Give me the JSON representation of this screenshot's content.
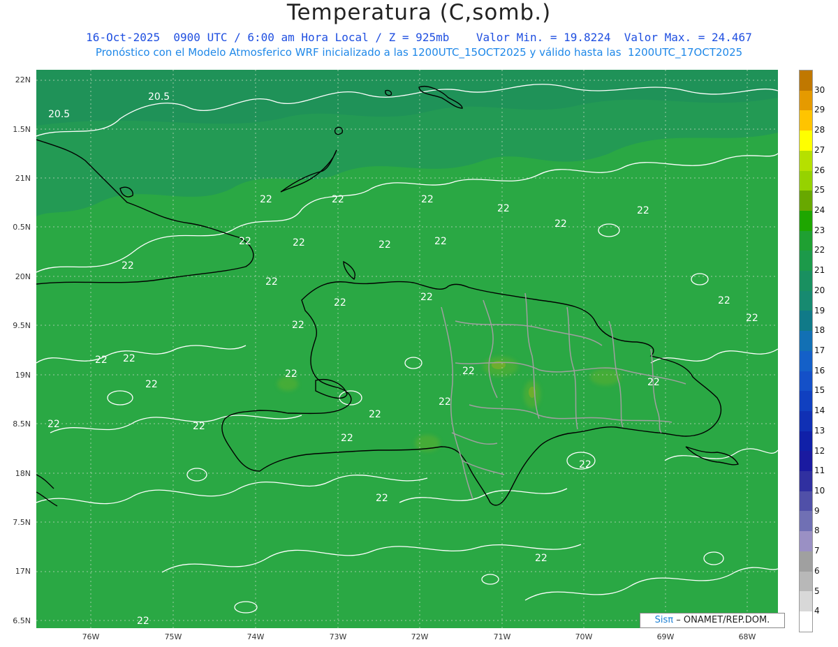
{
  "title": "Temperatura (C,somb.)",
  "subtitle1": "16-Oct-2025  0900 UTC / 6:00 am Hora Local / Z = 925mb    Valor Min. = 19.8224  Valor Max. = 24.467",
  "subtitle2": "Pronóstico con el Modelo Atmosferico WRF inicializado a las 1200UTC_15OCT2025 y válido hasta las  1200UTC_17OCT2025",
  "lat_labels": [
    "22N",
    "1.5N",
    "21N",
    "0.5N",
    "20N",
    "9.5N",
    "19N",
    "8.5N",
    "18N",
    "7.5N",
    "17N",
    "6.5N"
  ],
  "lon_labels": [
    "76W",
    "75W",
    "74W",
    "73W",
    "72W",
    "71W",
    "70W",
    "69W",
    "68W"
  ],
  "contour_labels": [
    "20.5",
    "20.5",
    "22",
    "22",
    "22",
    "22",
    "22",
    "22",
    "22",
    "22",
    "22",
    "22",
    "22",
    "22",
    "22",
    "22",
    "22",
    "22",
    "22",
    "22",
    "22",
    "22",
    "22",
    "22",
    "22",
    "22",
    "22",
    "22",
    "22",
    "22",
    "22",
    "22",
    "22",
    "22"
  ],
  "colorbar": {
    "labels": [
      "30",
      "29",
      "28",
      "27",
      "26",
      "25",
      "24",
      "23",
      "22",
      "21",
      "20",
      "19",
      "18",
      "17",
      "16",
      "15",
      "14",
      "13",
      "12",
      "11",
      "10",
      "9",
      "8",
      "7",
      "6",
      "5",
      "4"
    ],
    "colors": [
      "#c07800",
      "#e59a00",
      "#ffc400",
      "#ffff00",
      "#b6e000",
      "#96d200",
      "#68a800",
      "#1ea600",
      "#1fa032",
      "#1c9a4a",
      "#199060",
      "#178a70",
      "#107a88",
      "#1270b4",
      "#1460c8",
      "#1450c8",
      "#1040c0",
      "#1030b4",
      "#1020a8",
      "#1a1aa0",
      "#3030a0",
      "#5050a8",
      "#7070b4",
      "#9a90c4",
      "#a0a0a0",
      "#b8b8b8",
      "#d8d8d8",
      "#ffffff"
    ]
  },
  "credit_brand": "Sisπ",
  "credit_text": "– ONAMET/REP.DOM.",
  "colors": {
    "field_main": "#2aa844",
    "field_north": "#239a54",
    "field_warm": "#5cb02e",
    "contour": "#ffffff",
    "coast": "#000000",
    "provinces": "#a0a0a0"
  }
}
